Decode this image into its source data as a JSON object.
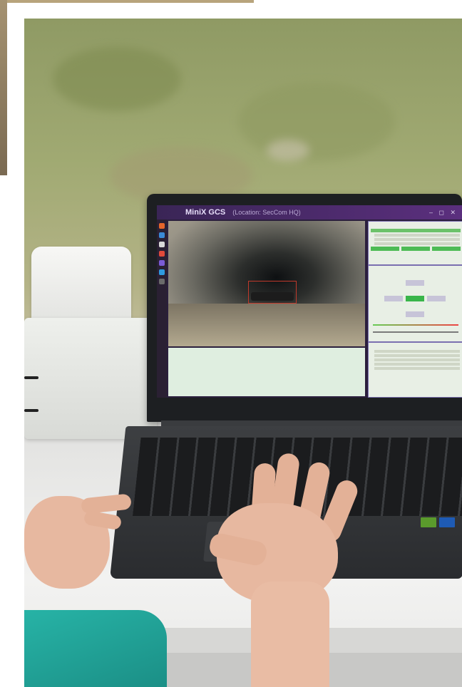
{
  "screen": {
    "app_title": "MiniX GCS",
    "location": "(Location: SecCom HQ)",
    "window_controls": "– ◻ ✕"
  },
  "colors": {
    "title_bar": "#3a2556",
    "panel_accent": "#39b54a",
    "sleeve": "#27b3a6"
  },
  "icons": [
    "drone-logo-icon",
    "dock-icons"
  ]
}
